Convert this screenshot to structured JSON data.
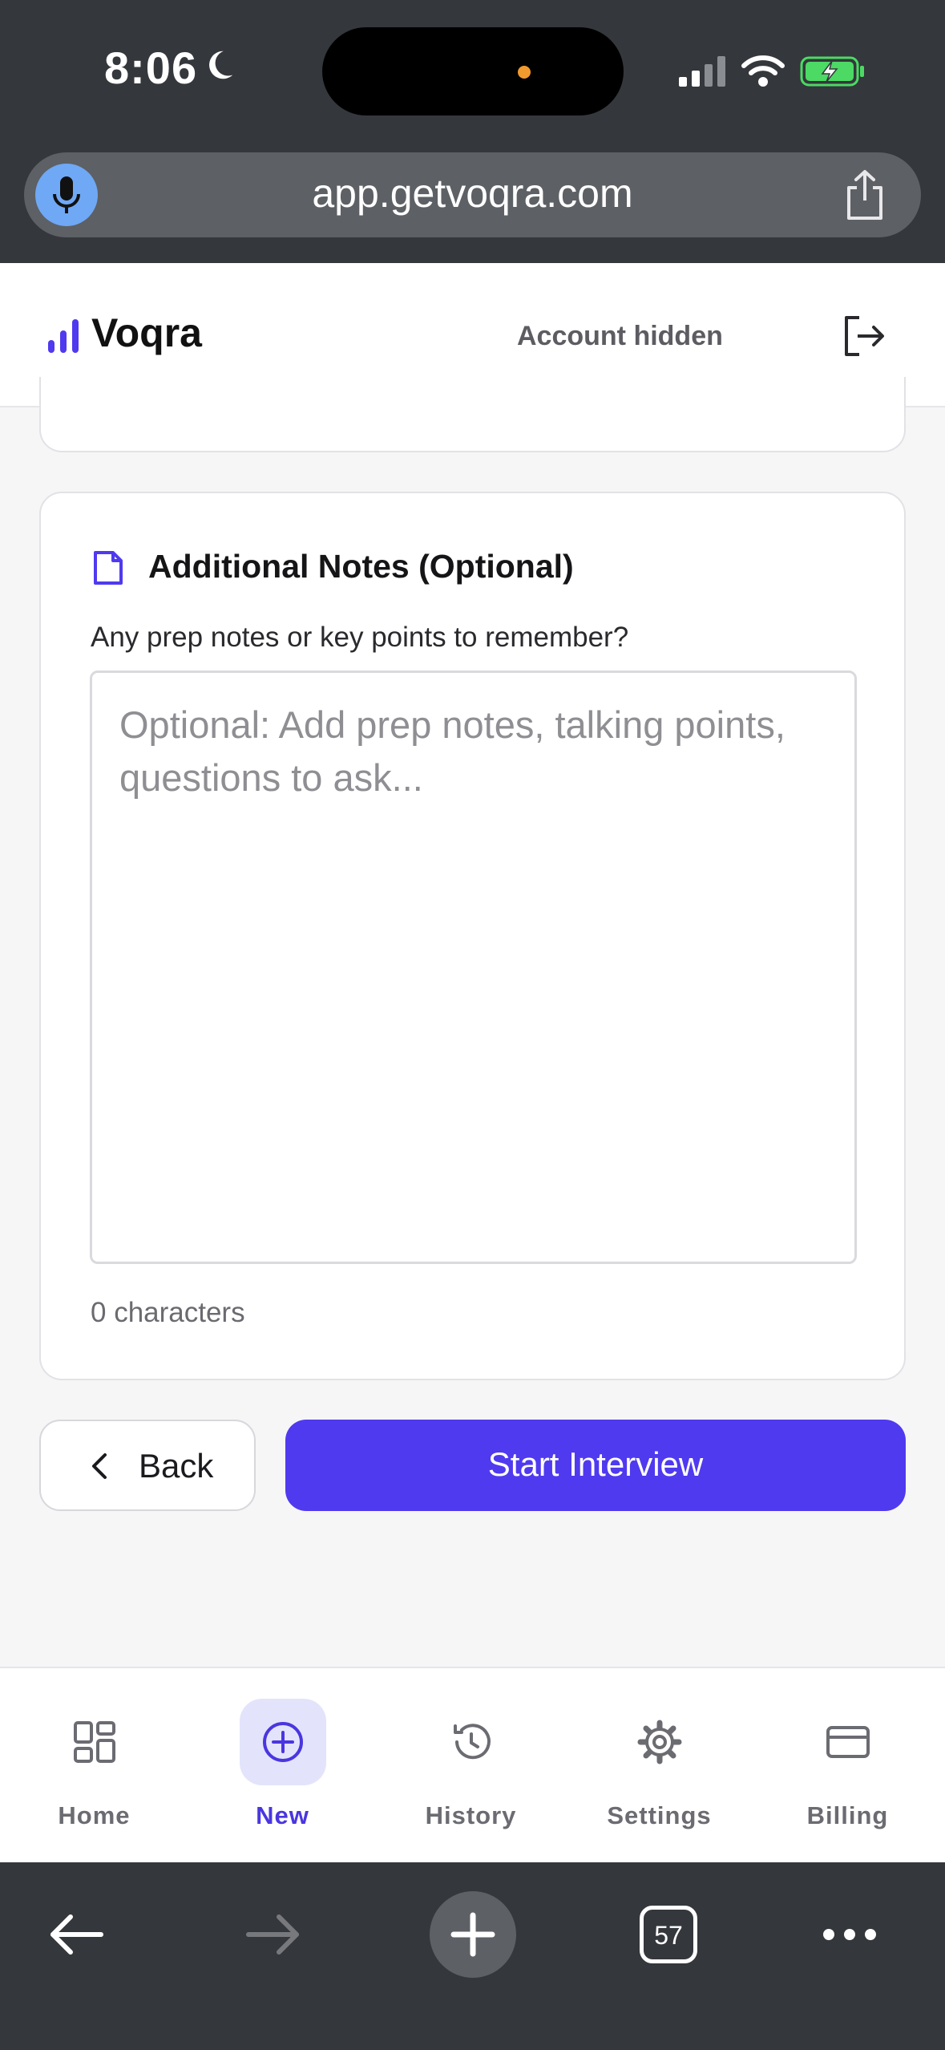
{
  "status_bar": {
    "time": "8:06"
  },
  "browser": {
    "url": "app.getvoqra.com",
    "tab_count": "57"
  },
  "header": {
    "logo_text": "Voqra",
    "account_label": "Account hidden"
  },
  "notes_card": {
    "title": "Additional Notes (Optional)",
    "question": "Any prep notes or key points to remember?",
    "placeholder": "Optional: Add prep notes, talking points, questions to ask...",
    "value": "",
    "char_count": "0 characters"
  },
  "actions": {
    "back_label": "Back",
    "start_label": "Start Interview"
  },
  "bottom_nav": {
    "items": [
      {
        "label": "Home",
        "icon": "grid-icon",
        "active": false
      },
      {
        "label": "New",
        "icon": "plus-circle-icon",
        "active": true
      },
      {
        "label": "History",
        "icon": "history-icon",
        "active": false
      },
      {
        "label": "Settings",
        "icon": "gear-icon",
        "active": false
      },
      {
        "label": "Billing",
        "icon": "credit-card-icon",
        "active": false
      }
    ]
  },
  "colors": {
    "accent": "#4f3af0",
    "chrome": "#34373b",
    "active_nav_bg": "#e3e4fb"
  }
}
